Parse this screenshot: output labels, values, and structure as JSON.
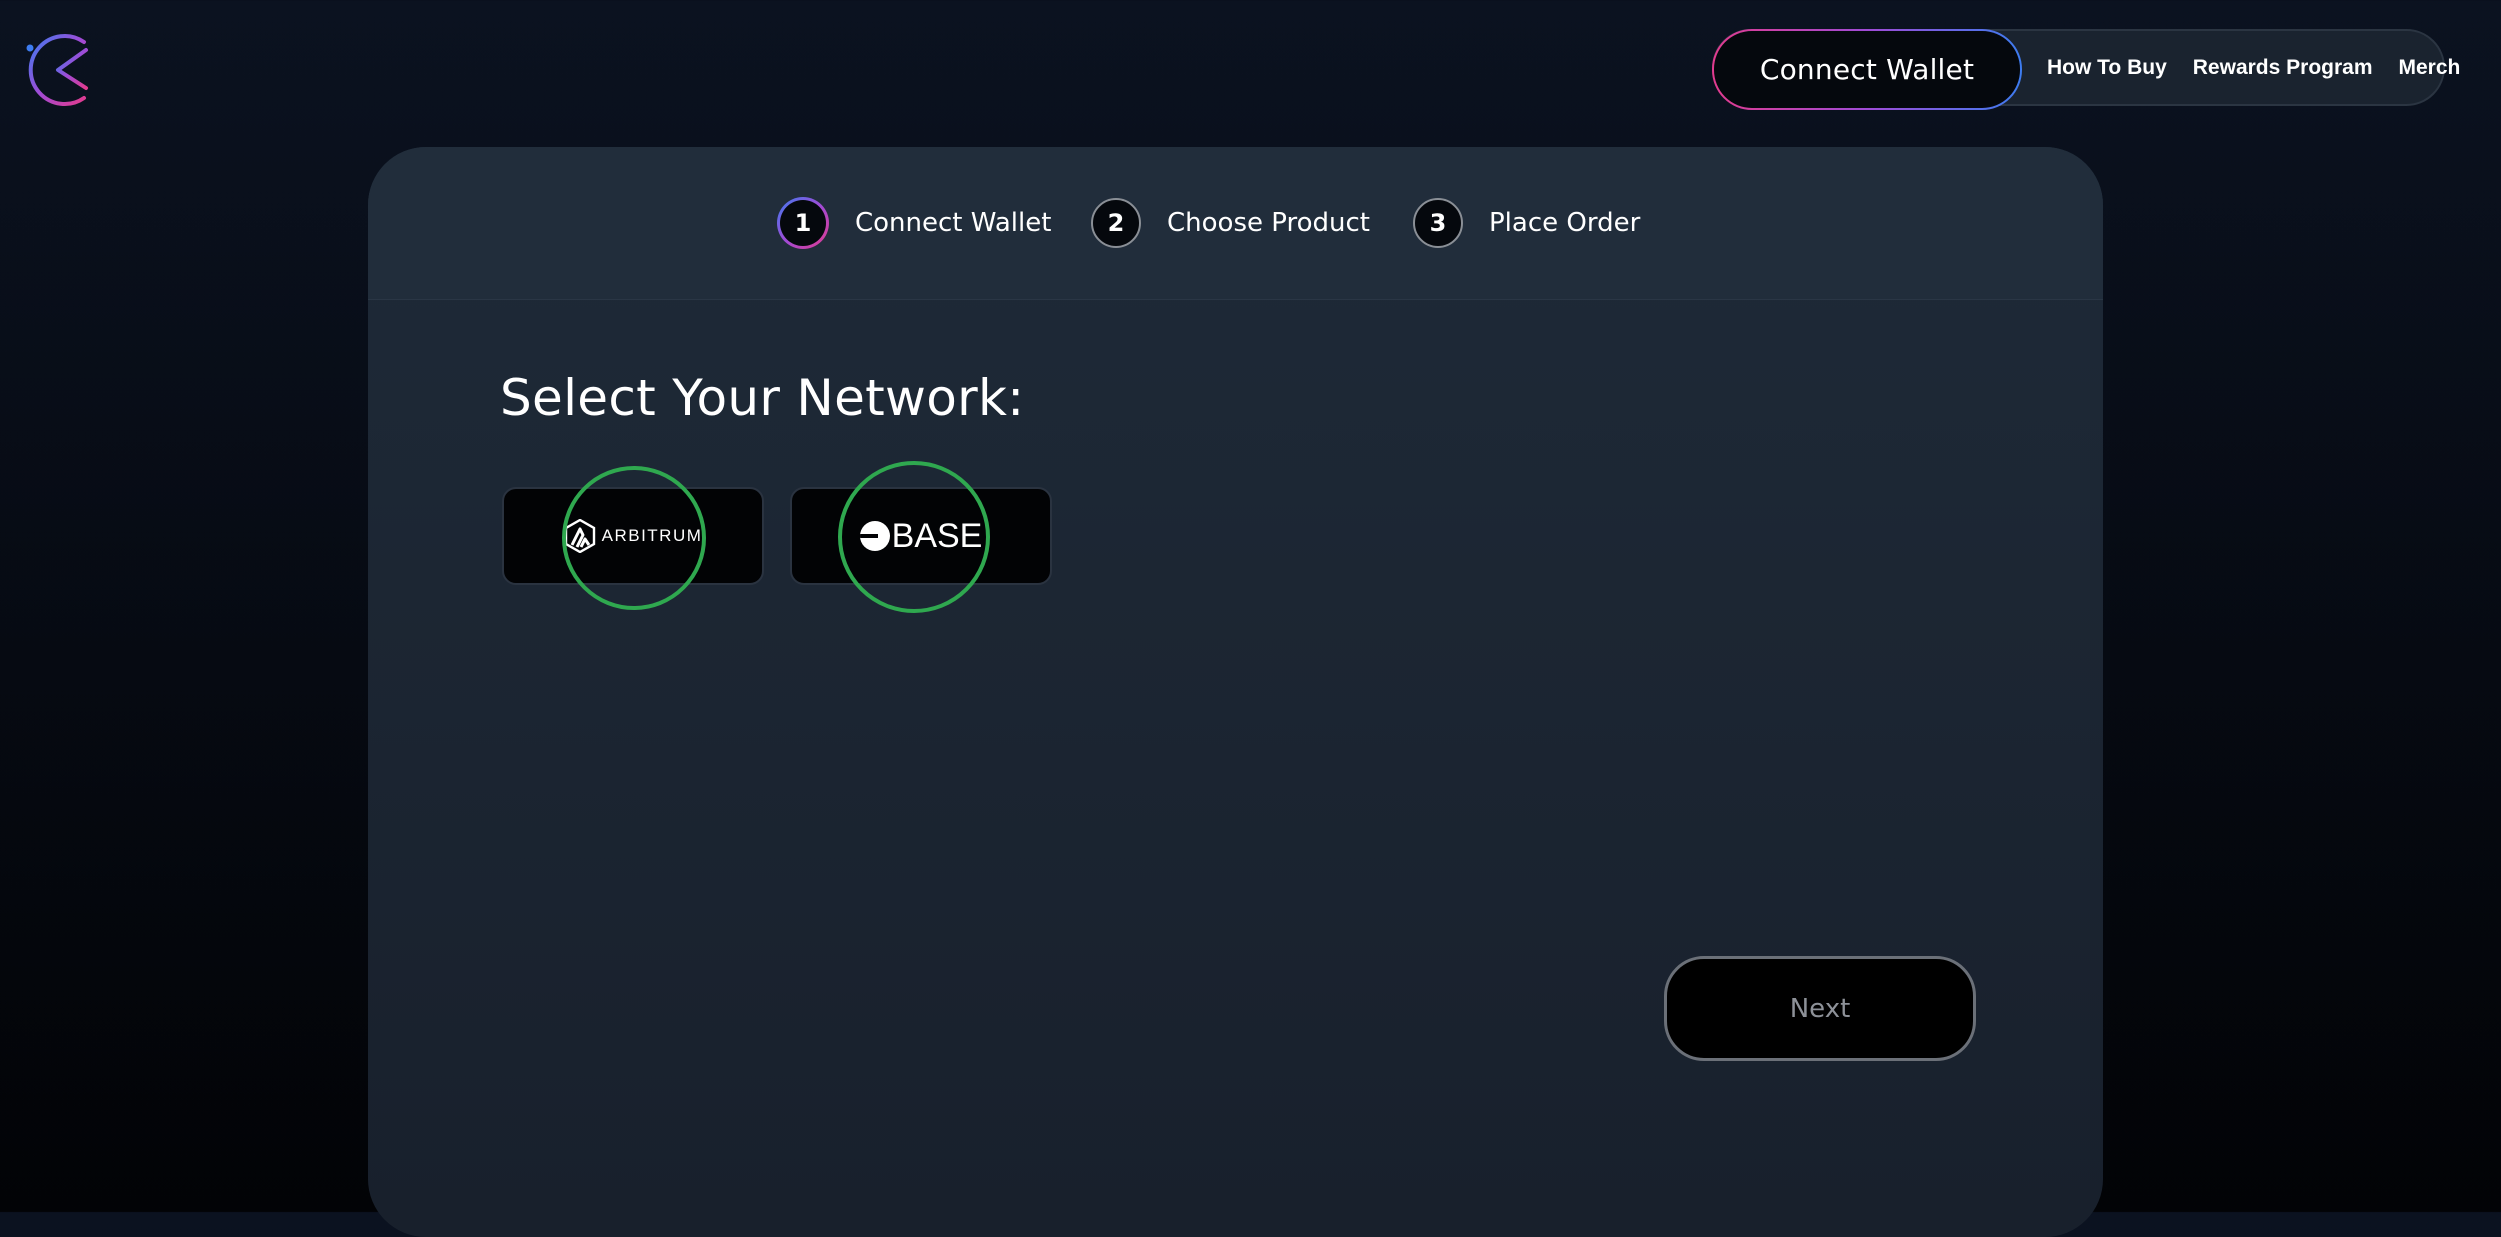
{
  "logo": {
    "icon": "c-logo-icon"
  },
  "nav": {
    "connect_wallet": "Connect Wallet",
    "links": [
      "How To Buy",
      "Rewards Program",
      "Merch"
    ]
  },
  "steps": [
    {
      "number": "1",
      "label": "Connect Wallet",
      "active": true
    },
    {
      "number": "2",
      "label": "Choose Product",
      "active": false
    },
    {
      "number": "3",
      "label": "Place Order",
      "active": false
    }
  ],
  "main": {
    "title": "Select Your Network:",
    "networks": [
      {
        "id": "arbitrum",
        "label": "ARBITRUM",
        "icon": "arbitrum-icon"
      },
      {
        "id": "base",
        "label": "BASE",
        "icon": "base-icon"
      }
    ],
    "next_label": "Next"
  },
  "colors": {
    "accent_start": "#e23b8e",
    "accent_mid": "#a04bd6",
    "accent_end": "#3d7cf0",
    "highlight": "#2fa84f"
  }
}
